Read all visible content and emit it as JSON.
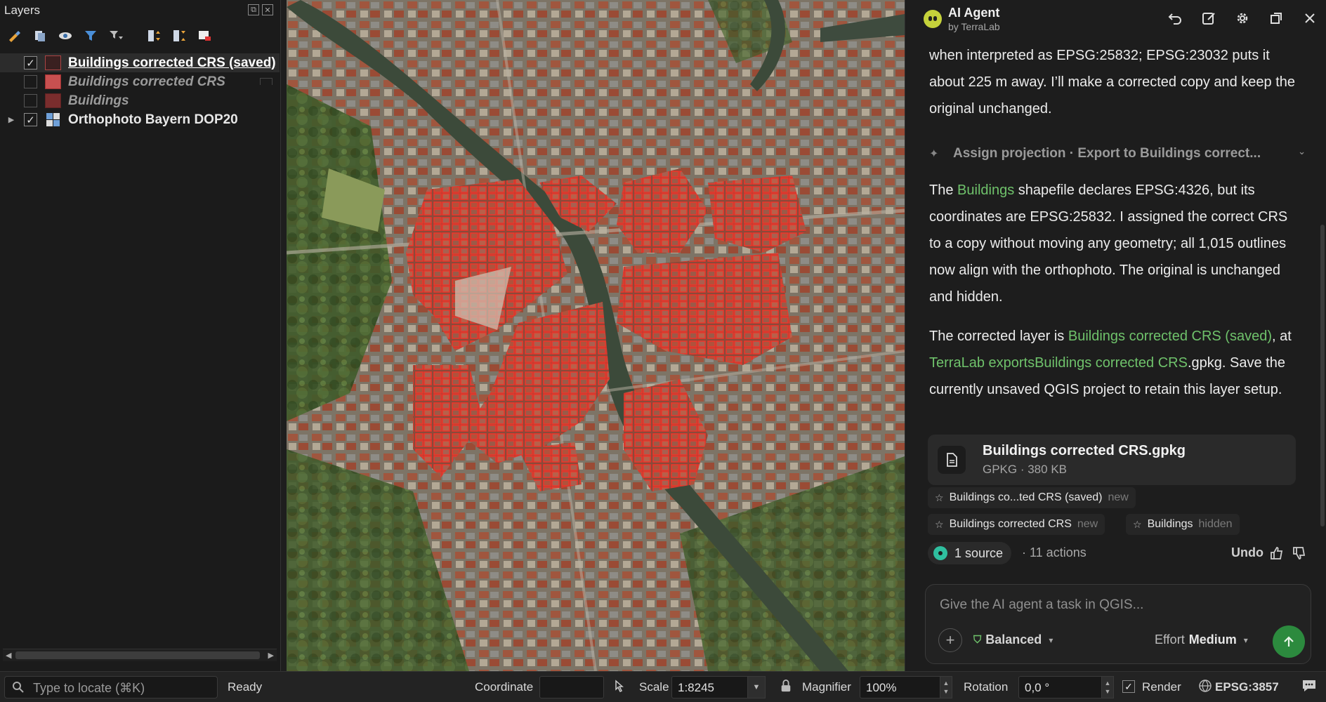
{
  "layers_panel": {
    "title": "Layers",
    "layers": [
      {
        "name": "Buildings corrected CRS (saved)",
        "checked": true
      },
      {
        "name": "Buildings corrected CRS",
        "checked": false
      },
      {
        "name": "Buildings",
        "checked": false
      },
      {
        "name": "Orthophoto Bayern DOP20",
        "checked": true
      }
    ]
  },
  "agent": {
    "title": "AI Agent",
    "subtitle": "by TerraLab",
    "intro_text": "when interpreted as EPSG:25832; EPSG:23032 puts it about 225 m away. I’ll make a corrected copy and keep the original unchanged.",
    "tool_call": "Assign projection · Export to Buildings correct...",
    "msg1": {
      "pre": "The ",
      "link": "Buildings",
      "post": " shapefile declares EPSG:4326, but its coordinates are EPSG:25832. I assigned the correct CRS to a copy without moving any geometry; all 1,015 outlines now align with the orthophoto. The original is unchanged and hidden."
    },
    "msg2": {
      "pre": "The corrected layer is ",
      "link1": "Buildings corrected CRS (saved)",
      "mid": ", at ",
      "link2": "TerraLab exportsBuildings corrected CRS",
      "post": ".gpkg. Save the currently unsaved QGIS project to retain this layer setup."
    },
    "file": {
      "name": "Buildings corrected CRS.gpkg",
      "meta": "GPKG · 380 KB"
    },
    "chips": [
      {
        "label": "Buildings co...ted CRS (saved)",
        "tag": "new"
      },
      {
        "label": "Buildings corrected CRS",
        "tag": "new"
      },
      {
        "label": "Buildings",
        "tag": "hidden"
      }
    ],
    "sources": "1 source",
    "actions": "· 11 actions",
    "undo": "Undo",
    "composer_placeholder": "Give the AI agent a task in QGIS...",
    "mode": "Balanced",
    "effort_label": "Effort",
    "effort_value": "Medium"
  },
  "status": {
    "locate_placeholder": "Type to locate (⌘K)",
    "ready": "Ready",
    "coordinate_label": "Coordinate",
    "coordinate_value": "",
    "scale_label": "Scale",
    "scale_value": "1:8245",
    "magnifier_label": "Magnifier",
    "magnifier_value": "100%",
    "rotation_label": "Rotation",
    "rotation_value": "0,0 °",
    "render_label": "Render",
    "crs": "EPSG:3857"
  },
  "colors": {
    "accent_green": "#6fc26b",
    "building_red": "#e63a2e",
    "send_button": "#2c8a3e"
  }
}
